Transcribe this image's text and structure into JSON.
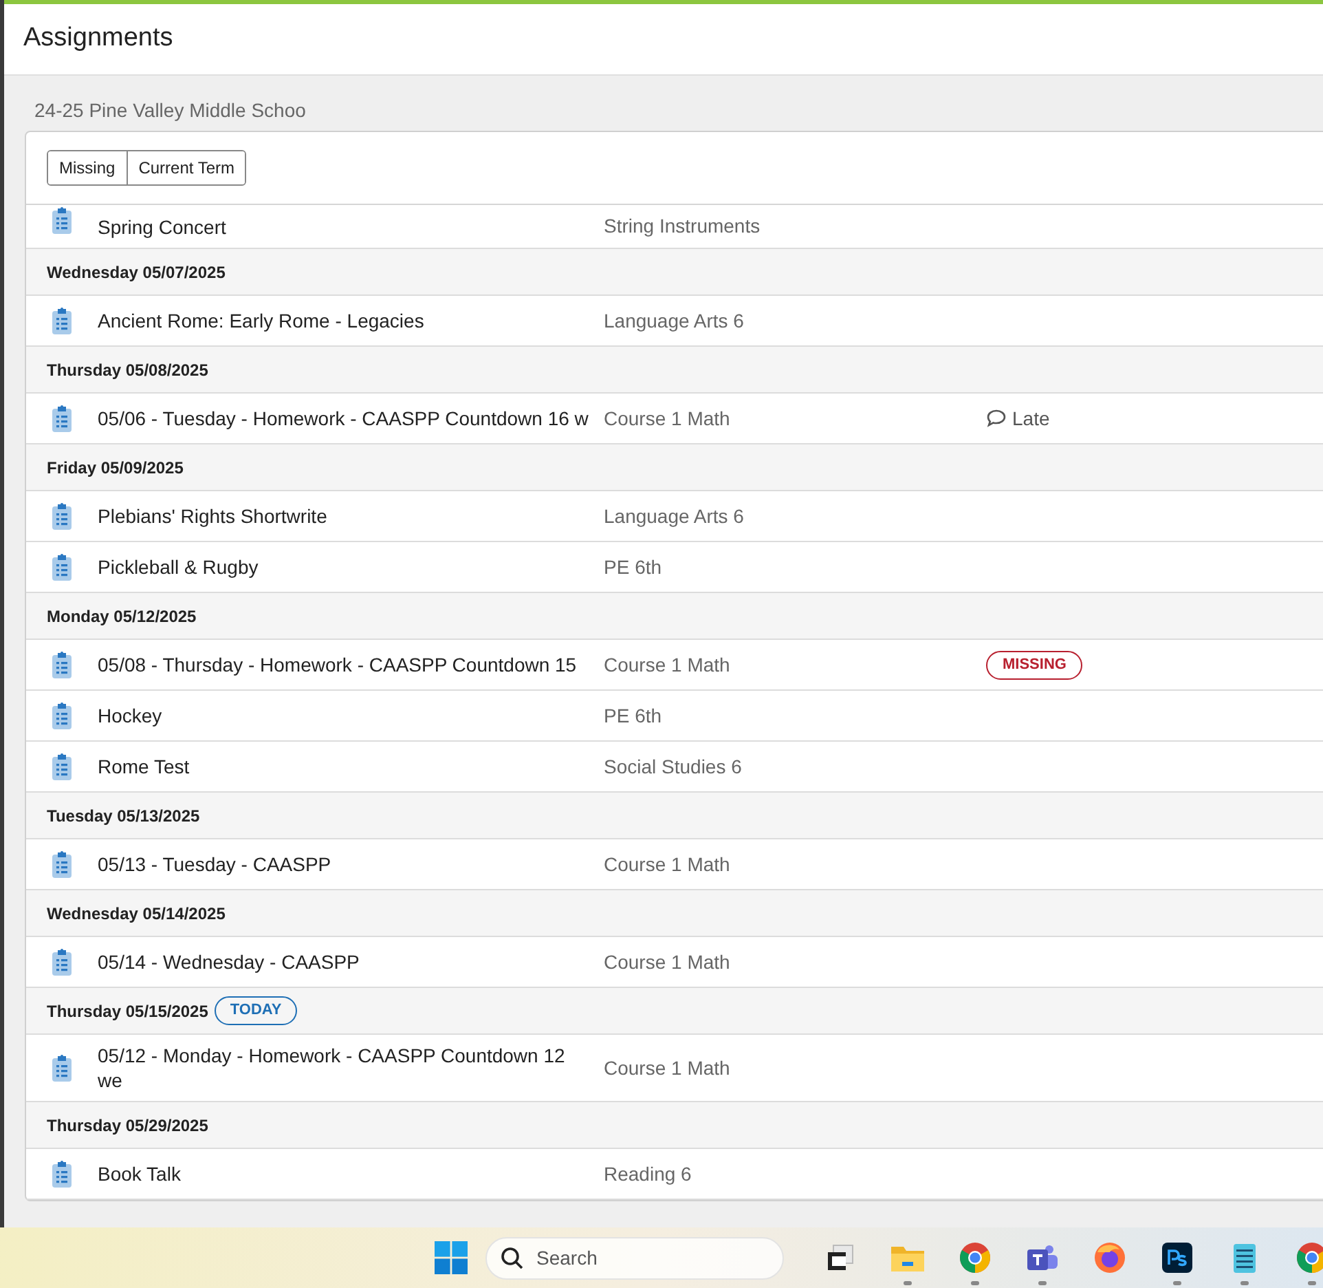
{
  "page_title": "Assignments",
  "school": "24-25 Pine Valley Middle Schoo",
  "filters": [
    {
      "label": "Missing"
    },
    {
      "label": "Current Term"
    }
  ],
  "groups": [
    {
      "items": [
        {
          "title": "Spring Concert",
          "course": "String Instruments"
        }
      ]
    },
    {
      "date": "Wednesday 05/07/2025",
      "items": [
        {
          "title": "Ancient Rome: Early Rome - Legacies",
          "course": "Language Arts 6"
        }
      ]
    },
    {
      "date": "Thursday 05/08/2025",
      "items": [
        {
          "title": "05/06 - Tuesday - Homework - CAASPP Countdown 16 w",
          "course": "Course 1 Math",
          "status": {
            "kind": "comment",
            "label": "Late"
          }
        }
      ]
    },
    {
      "date": "Friday 05/09/2025",
      "items": [
        {
          "title": "Plebians' Rights Shortwrite",
          "course": "Language Arts 6"
        },
        {
          "title": "Pickleball & Rugby",
          "course": "PE 6th"
        }
      ]
    },
    {
      "date": "Monday 05/12/2025",
      "items": [
        {
          "title": "05/08 - Thursday - Homework - CAASPP Countdown 15",
          "course": "Course 1 Math",
          "status": {
            "kind": "missing",
            "label": "MISSING"
          }
        },
        {
          "title": "Hockey",
          "course": "PE 6th"
        },
        {
          "title": "Rome Test",
          "course": "Social Studies 6"
        }
      ]
    },
    {
      "date": "Tuesday 05/13/2025",
      "items": [
        {
          "title": "05/13 - Tuesday - CAASPP",
          "course": "Course 1 Math"
        }
      ]
    },
    {
      "date": "Wednesday 05/14/2025",
      "items": [
        {
          "title": "05/14 - Wednesday - CAASPP",
          "course": "Course 1 Math"
        }
      ]
    },
    {
      "date": "Thursday 05/15/2025",
      "badge": "TODAY",
      "items": [
        {
          "title": "05/12 - Monday - Homework - CAASPP Countdown 12 we",
          "course": "Course 1 Math"
        }
      ]
    },
    {
      "date": "Thursday 05/29/2025",
      "items": [
        {
          "title": "Book Talk",
          "course": "Reading 6"
        }
      ]
    }
  ],
  "taskbar": {
    "search_placeholder": "Search",
    "apps": [
      {
        "kind": "task-view",
        "running": false
      },
      {
        "kind": "folder",
        "running": true
      },
      {
        "kind": "chrome",
        "running": true
      },
      {
        "kind": "teams",
        "running": true
      },
      {
        "kind": "firefox",
        "running": false
      },
      {
        "kind": "photoshop",
        "running": true
      },
      {
        "kind": "notepad",
        "running": true
      },
      {
        "kind": "chrome",
        "running": true
      }
    ]
  }
}
